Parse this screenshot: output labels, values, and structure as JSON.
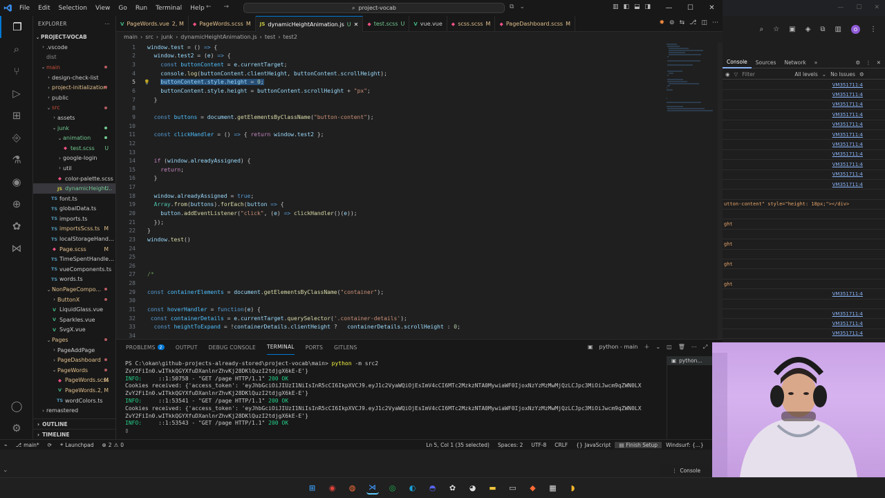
{
  "titlebar": {
    "menu": [
      "File",
      "Edit",
      "Selection",
      "View",
      "Go",
      "Run",
      "Terminal",
      "Help"
    ],
    "search": "project-vocab"
  },
  "sidebar": {
    "header": "EXPLORER",
    "root": "PROJECT-VOCAB",
    "items": [
      {
        "label": ".vscode",
        "depth": 1,
        "type": "folder",
        "open": false,
        "color": "normal"
      },
      {
        "label": "dist",
        "depth": 1,
        "type": "text",
        "color": "gray"
      },
      {
        "label": "main",
        "depth": 1,
        "type": "folder",
        "open": true,
        "color": "del",
        "dot": true
      },
      {
        "label": "design-check-list",
        "depth": 2,
        "type": "folder",
        "open": false,
        "color": "normal"
      },
      {
        "label": "project-initialization",
        "depth": 2,
        "type": "folder",
        "open": false,
        "color": "mod",
        "dot": true
      },
      {
        "label": "public",
        "depth": 2,
        "type": "folder",
        "open": false,
        "color": "normal"
      },
      {
        "label": "src",
        "depth": 2,
        "type": "folder",
        "open": true,
        "color": "del",
        "dot": true
      },
      {
        "label": "assets",
        "depth": 3,
        "type": "folder",
        "open": false,
        "color": "normal"
      },
      {
        "label": "junk",
        "depth": 3,
        "type": "folder",
        "open": true,
        "color": "unt",
        "dot": true
      },
      {
        "label": "animation",
        "depth": 4,
        "type": "folder",
        "open": true,
        "color": "unt",
        "dot": true
      },
      {
        "label": "test.scss",
        "depth": 5,
        "type": "scss",
        "color": "unt",
        "badge": "U"
      },
      {
        "label": "google-login",
        "depth": 4,
        "type": "folder",
        "open": false,
        "color": "normal"
      },
      {
        "label": "util",
        "depth": 4,
        "type": "folder",
        "open": false,
        "color": "normal"
      },
      {
        "label": "color-palette.scss",
        "depth": 4,
        "type": "scss",
        "color": "normal"
      },
      {
        "label": "dynamicHeight...",
        "depth": 4,
        "type": "js",
        "color": "unt",
        "badge": "U",
        "selected": true
      },
      {
        "label": "font.ts",
        "depth": 3,
        "type": "ts",
        "color": "normal"
      },
      {
        "label": "globalData.ts",
        "depth": 3,
        "type": "ts",
        "color": "normal"
      },
      {
        "label": "imports.ts",
        "depth": 3,
        "type": "ts",
        "color": "normal"
      },
      {
        "label": "importsScss.ts",
        "depth": 3,
        "type": "ts",
        "color": "mod",
        "badge": "M"
      },
      {
        "label": "localStorageHandler.ts",
        "depth": 3,
        "type": "ts",
        "color": "normal"
      },
      {
        "label": "Page.scss",
        "depth": 3,
        "type": "scss",
        "color": "mod",
        "badge": "M"
      },
      {
        "label": "TimeSpentHandler.ts",
        "depth": 3,
        "type": "ts",
        "color": "normal"
      },
      {
        "label": "vueComponents.ts",
        "depth": 3,
        "type": "ts",
        "color": "normal"
      },
      {
        "label": "words.ts",
        "depth": 3,
        "type": "ts",
        "color": "normal"
      },
      {
        "label": "NonPageCompo...",
        "depth": 2,
        "type": "folder",
        "open": true,
        "color": "mod",
        "dot": true
      },
      {
        "label": "ButtonX",
        "depth": 3,
        "type": "folder",
        "open": false,
        "color": "mod",
        "dot": true
      },
      {
        "label": "LiquidGlass.vue",
        "depth": 3,
        "type": "vue",
        "color": "normal"
      },
      {
        "label": "Sparkles.vue",
        "depth": 3,
        "type": "vue",
        "color": "normal"
      },
      {
        "label": "SvgX.vue",
        "depth": 3,
        "type": "vue",
        "color": "normal"
      },
      {
        "label": "Pages",
        "depth": 2,
        "type": "folder",
        "open": true,
        "color": "mod",
        "dot": true
      },
      {
        "label": "PageAddPage",
        "depth": 3,
        "type": "folder",
        "open": false,
        "color": "normal"
      },
      {
        "label": "PageDashboard",
        "depth": 3,
        "type": "folder",
        "open": false,
        "color": "mod",
        "dot": true
      },
      {
        "label": "PageWords",
        "depth": 3,
        "type": "folder",
        "open": true,
        "color": "mod",
        "dot": true
      },
      {
        "label": "PageWords.scss",
        "depth": 4,
        "type": "scss",
        "color": "mod",
        "badge": "M"
      },
      {
        "label": "PageWords...",
        "depth": 4,
        "type": "vue",
        "color": "mod",
        "badge": "2, M"
      },
      {
        "label": "wordColors.ts",
        "depth": 4,
        "type": "ts",
        "color": "normal"
      },
      {
        "label": "remastered",
        "depth": 1,
        "type": "folder",
        "open": false,
        "color": "normal"
      }
    ],
    "outline": "OUTLINE",
    "timeline": "TIMELINE"
  },
  "tabs": [
    {
      "label": "PageWords.vue",
      "status": "2, M",
      "type": "vue",
      "color": "mod"
    },
    {
      "label": "PageWords.scss",
      "status": "M",
      "type": "scss",
      "color": "mod"
    },
    {
      "label": "dynamicHeightAnimation.js",
      "status": "U",
      "type": "js",
      "color": "unt",
      "active": true
    },
    {
      "label": "test.scss",
      "status": "U",
      "type": "scss",
      "color": "unt"
    },
    {
      "label": "vue.vue",
      "status": "",
      "type": "vue",
      "color": "normal"
    },
    {
      "label": "scss.scss",
      "status": "M",
      "type": "scss",
      "color": "mod"
    },
    {
      "label": "PageDashboard.scss",
      "status": "M",
      "type": "scss",
      "color": "mod"
    }
  ],
  "breadcrumb": [
    "main",
    "src",
    "junk",
    "dynamicHeightAnimation.js",
    "test",
    "test2"
  ],
  "code": [
    {
      "n": "1",
      "t": "window.test = () => {"
    },
    {
      "n": "2",
      "t": "  window.test2 = (e) => {"
    },
    {
      "n": "3",
      "t": "    const buttonContent = e.currentTarget;"
    },
    {
      "n": "4",
      "t": "    console.log(buttonContent.clientHeight, buttonContent.scrollHeight);"
    },
    {
      "n": "5",
      "t": "    buttonContent.style.height = 0;",
      "sel": true
    },
    {
      "n": "6",
      "t": "    buttonContent.style.height = buttonContent.scrollHeight + \"px\";"
    },
    {
      "n": "7",
      "t": "  }"
    },
    {
      "n": "8",
      "t": ""
    },
    {
      "n": "9",
      "t": "  const buttons = document.getElementsByClassName(\"button-content\");"
    },
    {
      "n": "10",
      "t": ""
    },
    {
      "n": "11",
      "t": "  const clickHandler = () => { return window.test2 };"
    },
    {
      "n": "12",
      "t": ""
    },
    {
      "n": "13",
      "t": ""
    },
    {
      "n": "14",
      "t": "  if (window.alreadyAssigned) {"
    },
    {
      "n": "15",
      "t": "    return;"
    },
    {
      "n": "16",
      "t": "  }"
    },
    {
      "n": "17",
      "t": ""
    },
    {
      "n": "18",
      "t": "  window.alreadyAssigned = true;"
    },
    {
      "n": "19",
      "t": "  Array.from(buttons).forEach(button => {"
    },
    {
      "n": "20",
      "t": "    button.addEventListener(\"click\", (e) => clickHandler()(e));"
    },
    {
      "n": "21",
      "t": "  });"
    },
    {
      "n": "22",
      "t": "}"
    },
    {
      "n": "23",
      "t": "window.test()"
    },
    {
      "n": "24",
      "t": ""
    },
    {
      "n": "25",
      "t": ""
    },
    {
      "n": "26",
      "t": ""
    },
    {
      "n": "27",
      "t": "/*"
    },
    {
      "n": "28",
      "t": ""
    },
    {
      "n": "29",
      "t": "const containerElements = document.getElementsByClassName(\"container\");"
    },
    {
      "n": "30",
      "t": ""
    },
    {
      "n": "31",
      "t": "const hoverHandler = function(e) {"
    },
    {
      "n": "32",
      "t": " const containerDetails = e.currentTarget.querySelector('.container-details');"
    },
    {
      "n": "33",
      "t": "  const heightToExpand = !containerDetails.clientHeight ?   containerDetails.scrollHeight : 0;"
    },
    {
      "n": "34",
      "t": ""
    }
  ],
  "panel": {
    "tabs": [
      {
        "label": "PROBLEMS",
        "badge": "2"
      },
      {
        "label": "OUTPUT"
      },
      {
        "label": "DEBUG CONSOLE"
      },
      {
        "label": "TERMINAL",
        "active": true
      },
      {
        "label": "PORTS"
      },
      {
        "label": "GITLENS"
      }
    ],
    "terminal_name": "python - main",
    "side_label": "python...",
    "terminal_lines": [
      "PS C:\\okan\\github-projects-already-stored\\project-vocab\\main> python -m src2",
      "ZvY2FiIn0.wITkkQGYXfuDXanlnrZhvKj28DKlQuzI2tdjgX6kE-E'}",
      "INFO:     ::1:50758 - \"GET /page HTTP/1.1\" 200 OK",
      "Cookies received: {'access_token': 'eyJhbGciOiJIUzI1NiIsInR5cCI6IkpXVCJ9.eyJ1c2VyaWQiOjEsImV4cCI6MTc2MzkzNTA0MywiaWF0IjoxNzYzMzMwMjQzLCJpc3MiOiJwcm9qZWN0LX",
      "ZvY2FiIn0.wITkkQGYXfuDXanlnrZhvKj28DKlQuzI2tdjgX6kE-E'}",
      "INFO:     ::1:53541 - \"GET /page HTTP/1.1\" 200 OK",
      "Cookies received: {'access_token': 'eyJhbGciOiJIUzI1NiIsInR5cCI6IkpXVCJ9.eyJ1c2VyaWQiOjEsImV4cCI6MTc2MzkzNTA0MywiaWF0IjoxNzYzMzMwMjQzLCJpc3MiOiJwcm9qZWN0LX",
      "ZvY2FiIn0.wITkkQGYXfuDXanlnrZhvKj28DKlQuzI2tdjgX6kE-E'}",
      "INFO:     ::1:53543 - \"GET /page HTTP/1.1\" 200 OK",
      ""
    ]
  },
  "statusbar": {
    "branch": "main*",
    "launchpad": "Launchpad",
    "errors": "2",
    "warnings": "0",
    "position": "Ln 5, Col 1 (35 selected)",
    "spaces": "Spaces: 2",
    "encoding": "UTF-8",
    "eol": "CRLF",
    "language": "JavaScript",
    "finish": "Finish Setup",
    "windsurf": "Windsurf: {...}"
  },
  "devtools": {
    "tabs": [
      "Console",
      "Sources",
      "Network"
    ],
    "filter_placeholder": "Filter",
    "levels": "All levels",
    "issues": "No Issues",
    "log_link": "VM351711:4",
    "fragment": "utton-content\" style=\"height: 18px;\"></div>",
    "fragment2": "ght",
    "console_btn": "Console"
  },
  "taskbar": [
    "windows-icon",
    "chrome-icon",
    "firefox-icon",
    "vscode-icon",
    "spotify-icon",
    "edge-icon",
    "discord-icon",
    "openai-icon",
    "github-icon",
    "files-icon",
    "terminal-icon",
    "postman-icon",
    "calculator-icon",
    "app-icon"
  ]
}
